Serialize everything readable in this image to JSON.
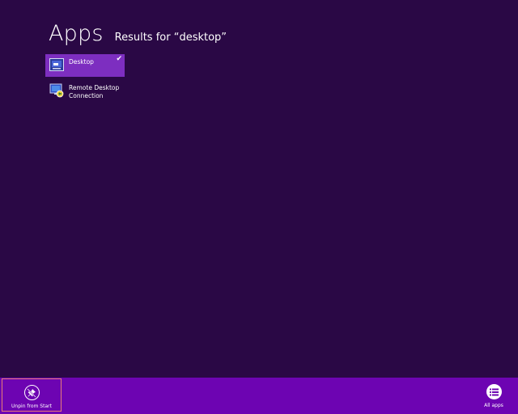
{
  "header": {
    "title": "Apps",
    "results": "Results for “desktop”"
  },
  "results": [
    {
      "label_lines": [
        "Desktop"
      ],
      "icon": "desktop-icon",
      "selected": true
    },
    {
      "label_lines": [
        "Remote Desktop",
        "Connection"
      ],
      "icon": "remote-desktop-icon",
      "selected": false
    }
  ],
  "appbar": {
    "unpin_label": "Unpin from Start",
    "unpin_icon": "unpin-icon",
    "all_apps_label": "All apps",
    "all_apps_icon": "list-icon"
  },
  "colors": {
    "background": "#2a0845",
    "selected_tile": "#7d2ec0",
    "appbar": "#6d04b2",
    "focus_border": "#e87d78"
  }
}
